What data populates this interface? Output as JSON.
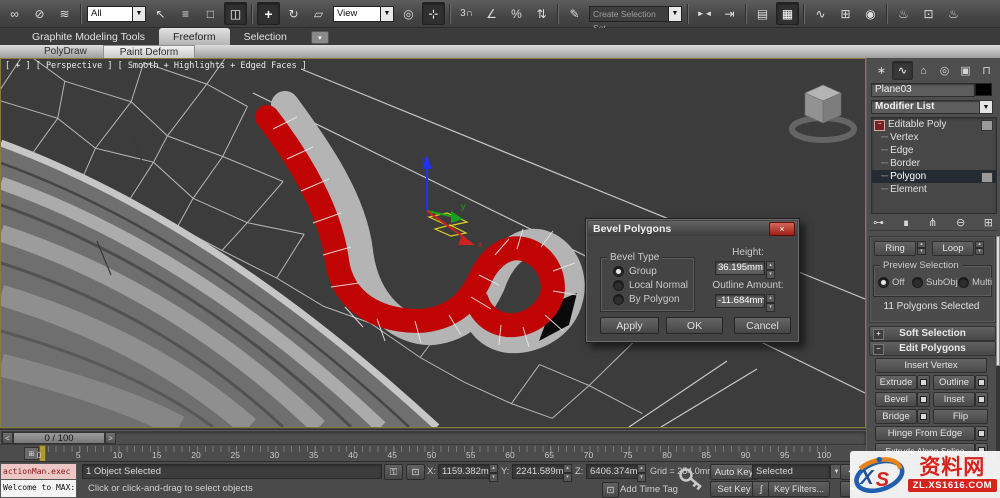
{
  "icons": {
    "spinner_up": "▴",
    "spinner_down": "▾",
    "dropdown": "▼",
    "minimize": "▾",
    "plus": "+",
    "minus": "−",
    "tree_dash": "─",
    "close": "×",
    "play_start": "◄◄",
    "play_prev": "◄",
    "play_next": "►",
    "lock_glyph": "⚿",
    "region_glyph": "⊡",
    "curve_glyph": "∫",
    "trackbar_glyph": "⊞"
  },
  "toolbar": {
    "filter_value": "All",
    "coord_value": "View",
    "named_set_placeholder": "Create Selection Set",
    "items": [
      {
        "name": "select-and-link-icon",
        "glyph": "∞"
      },
      {
        "name": "unlink-selection-icon",
        "glyph": "⊘"
      },
      {
        "name": "bind-to-space-warp-icon",
        "glyph": "≋"
      },
      {
        "name": "select-object-icon",
        "glyph": "↖"
      },
      {
        "name": "select-by-name-icon",
        "glyph": "≡"
      },
      {
        "name": "rectangular-selection-region-icon",
        "glyph": "□"
      },
      {
        "name": "window-crossing-icon",
        "glyph": "◫"
      },
      {
        "name": "select-and-move-icon",
        "glyph": "+"
      },
      {
        "name": "select-and-rotate-icon",
        "glyph": "↻"
      },
      {
        "name": "select-and-scale-icon",
        "glyph": "▱"
      },
      {
        "name": "use-center-icon",
        "glyph": "◎"
      },
      {
        "name": "select-and-manipulate-icon",
        "glyph": "⊹"
      },
      {
        "name": "snaps-toggle-icon",
        "glyph": "3∩"
      },
      {
        "name": "angle-snap-icon",
        "glyph": "∠"
      },
      {
        "name": "percent-snap-icon",
        "glyph": "%"
      },
      {
        "name": "spinner-snap-icon",
        "glyph": "⇅"
      },
      {
        "name": "edit-named-selection-sets-icon",
        "glyph": "✎"
      },
      {
        "name": "mirror-icon",
        "glyph": "►◄"
      },
      {
        "name": "align-icon",
        "glyph": "⇥"
      },
      {
        "name": "layer-manager-icon",
        "glyph": "▤"
      },
      {
        "name": "graphite-toggle-icon",
        "glyph": "▦"
      },
      {
        "name": "curve-editor-icon",
        "glyph": "∿"
      },
      {
        "name": "schematic-view-icon",
        "glyph": "⊞"
      },
      {
        "name": "material-editor-icon",
        "glyph": "◉"
      },
      {
        "name": "render-setup-icon",
        "glyph": "♨"
      },
      {
        "name": "rendered-frame-window-icon",
        "glyph": "⊡"
      },
      {
        "name": "render-production-icon",
        "glyph": "♨"
      }
    ]
  },
  "ribbon": {
    "tabs": [
      {
        "label": "Graphite Modeling Tools"
      },
      {
        "label": "Freeform"
      },
      {
        "label": "Selection"
      }
    ],
    "active_tab": "Freeform",
    "subtabs": [
      {
        "label": "PolyDraw"
      },
      {
        "label": "Paint Deform"
      }
    ]
  },
  "viewport": {
    "label": "[ + ] [ Perspective ] [ Smooth + Highlights + Edged Faces ]",
    "axis": {
      "x": "x",
      "y": "y",
      "z": "z"
    }
  },
  "dialog": {
    "title": "Bevel Polygons",
    "group_label": "Bevel Type",
    "radio_group": "Group",
    "radio_local_normal": "Local Normal",
    "radio_by_polygon": "By Polygon",
    "selected_radio": "Group",
    "height_label": "Height:",
    "height_value": "36.195mm",
    "outline_label": "Outline Amount:",
    "outline_value": "-11.684mm",
    "apply_label": "Apply",
    "ok_label": "OK",
    "cancel_label": "Cancel"
  },
  "rightPanel": {
    "tabs": [
      {
        "name": "create",
        "glyph": "∗"
      },
      {
        "name": "modify",
        "glyph": "∿"
      },
      {
        "name": "hierarchy",
        "glyph": "⌂"
      },
      {
        "name": "motion",
        "glyph": "◎"
      },
      {
        "name": "display",
        "glyph": "▣"
      },
      {
        "name": "utilities",
        "glyph": "⊓"
      }
    ],
    "active_tab": "modify",
    "object_name": "Plane03",
    "modifier_list_label": "Modifier List",
    "stack": [
      {
        "label": "Editable Poly"
      },
      {
        "label": "Vertex"
      },
      {
        "label": "Edge"
      },
      {
        "label": "Border"
      },
      {
        "label": "Polygon"
      },
      {
        "label": "Element"
      }
    ],
    "selected_stack_item": "Polygon",
    "stack_tools": [
      {
        "name": "pin-stack-icon",
        "glyph": "⊶"
      },
      {
        "name": "show-end-result-icon",
        "glyph": "∎"
      },
      {
        "name": "make-unique-icon",
        "glyph": "⋔"
      },
      {
        "name": "remove-modifier-icon",
        "glyph": "⊖"
      },
      {
        "name": "configure-modifier-sets-icon",
        "glyph": "⊞"
      }
    ],
    "ring_label": "Ring",
    "loop_label": "Loop",
    "preview_selection_label": "Preview Selection",
    "radio_off": "Off",
    "radio_subobj": "SubObj",
    "radio_multi": "Multi",
    "selected_preview": "Off",
    "selection_status": "11 Polygons Selected",
    "soft_selection_label": "Soft Selection",
    "edit_polygons_label": "Edit Polygons",
    "buttons": {
      "insert_vertex": "Insert Vertex",
      "extrude": "Extrude",
      "outline": "Outline",
      "bevel": "Bevel",
      "inset": "Inset",
      "bridge": "Bridge",
      "flip": "Flip",
      "hinge_from_edge": "Hinge From Edge",
      "extrude_along_spline": "Extrude Along Spline"
    }
  },
  "timeline": {
    "slider_value": "0 / 100",
    "prev_label": "<",
    "next_label": ">",
    "ruler_labels": [
      "0",
      "5",
      "10",
      "15",
      "20",
      "25",
      "30",
      "35",
      "40",
      "45",
      "50",
      "55",
      "60",
      "65",
      "70",
      "75",
      "80",
      "85",
      "90",
      "95",
      "100"
    ]
  },
  "statusBar": {
    "listener_line1": "actionMan.exec",
    "listener_line2": "Welcome to MAX:",
    "status": "1 Object Selected",
    "prompt": "Click or click-and-drag to select objects",
    "x_label": "X:",
    "x_value": "1159.382mm",
    "y_label": "Y:",
    "y_value": "2241.589mm",
    "z_label": "Z:",
    "z_value": "6406.374mm",
    "grid_label": "Grid = 254.0mm",
    "add_time_tag": "Add Time Tag",
    "auto_key": "Auto Key",
    "set_key": "Set Key",
    "selected_filter": "Selected",
    "key_filters": "Key Filters...",
    "time_value": "0"
  },
  "watermark": {
    "logo_x": "X",
    "logo_s": "S",
    "site": "资料网",
    "url": "ZL.XS1616.COM"
  },
  "colors": {
    "selection_red": "#c00303",
    "band_gray": "#b4b4b4",
    "viewport_bg": "#3c3c3c",
    "viewport_border": "#8a7c36",
    "stack_highlight": "#242b33",
    "watermark_red": "#d6231c",
    "logo_blue": "#1f5fae",
    "axis_x": "#cc2222",
    "axis_y": "#18a018",
    "axis_z": "#2233ee"
  }
}
